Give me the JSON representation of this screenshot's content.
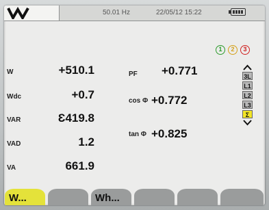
{
  "status": {
    "frequency": "50.01 Hz",
    "datetime": "22/05/12 15:22",
    "mode_icon": "W"
  },
  "phase_indicators": [
    "1",
    "2",
    "3"
  ],
  "left_measurements": [
    {
      "label": "W",
      "value": "+510.1"
    },
    {
      "label": "Wdc",
      "value": "+0.7"
    },
    {
      "label": "VAR",
      "value": "Ɛ419.8"
    },
    {
      "label": "VAD",
      "value": "1.2"
    },
    {
      "label": "VA",
      "value": "661.9"
    }
  ],
  "right_measurements": [
    {
      "label": "PF",
      "value": "+0.771"
    },
    {
      "label": "cos Φ",
      "value": "+0.772"
    },
    {
      "label": "tan Φ",
      "value": "+0.825"
    }
  ],
  "channel_selector": [
    "3L",
    "L1",
    "L2",
    "L3",
    "Σ"
  ],
  "selected_channel": "Σ",
  "softkeys": [
    "W...",
    "",
    "Wh...",
    "",
    "",
    ""
  ],
  "colors": {
    "active_key": "#e4e23a",
    "phase1": "#2a9a2a",
    "phase2": "#d4a017",
    "phase3": "#d02020"
  }
}
